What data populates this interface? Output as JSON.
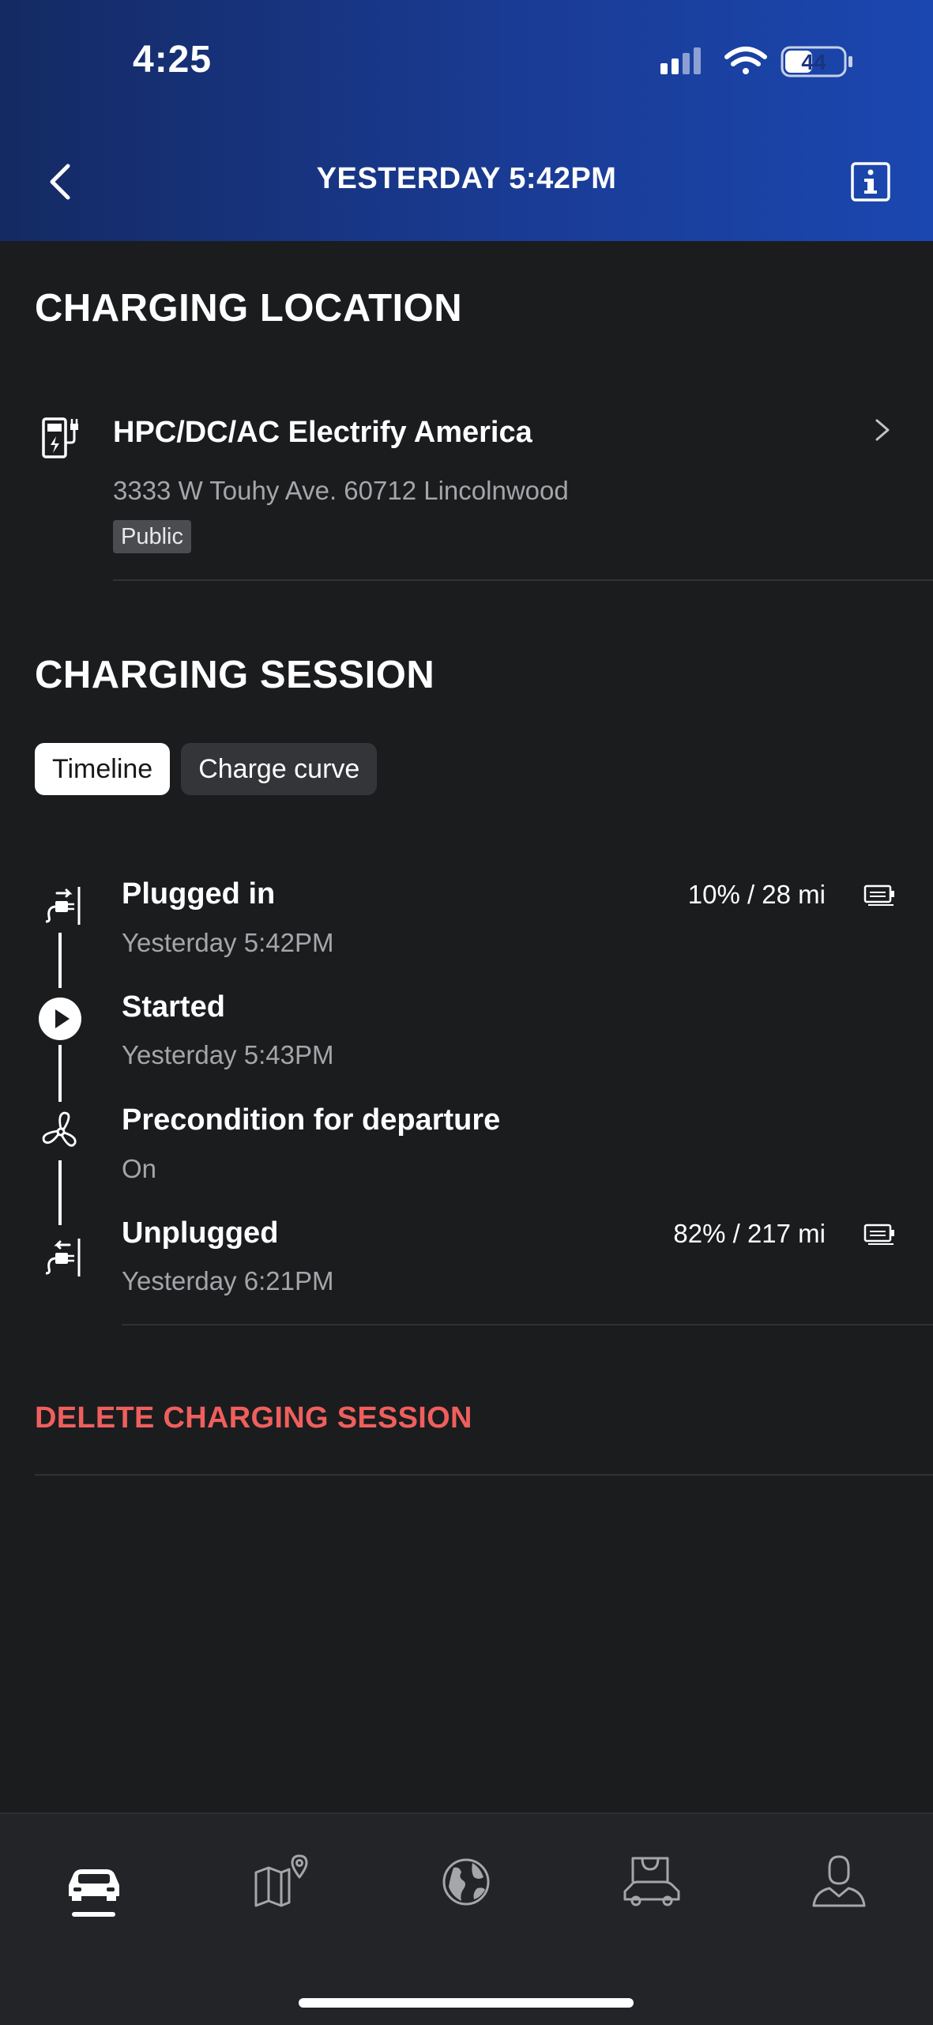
{
  "status_bar": {
    "time": "4:25",
    "battery": "44"
  },
  "nav": {
    "title": "YESTERDAY 5:42PM"
  },
  "charging_location": {
    "heading": "CHARGING LOCATION",
    "name": "HPC/DC/AC Electrify America",
    "address": "3333 W Touhy Ave. 60712 Lincolnwood",
    "badge": "Public"
  },
  "charging_session": {
    "heading": "CHARGING SESSION",
    "tabs": [
      {
        "label": "Timeline",
        "active": true
      },
      {
        "label": "Charge curve",
        "active": false
      }
    ],
    "events": [
      {
        "title": "Plugged in",
        "subtitle": "Yesterday 5:42PM",
        "right": "10% / 28 mi",
        "icon": "plug-icon"
      },
      {
        "title": "Started",
        "subtitle": "Yesterday 5:43PM",
        "icon": "play-circle-icon"
      },
      {
        "title": "Precondition for departure",
        "subtitle": "On",
        "icon": "fan-icon"
      },
      {
        "title": "Unplugged",
        "subtitle": "Yesterday 6:21PM",
        "right": "82% / 217 mi",
        "icon": "unplug-icon"
      }
    ]
  },
  "actions": {
    "delete_label": "DELETE CHARGING SESSION"
  },
  "tab_bar": {
    "items": [
      {
        "icon": "car-icon",
        "active": true
      },
      {
        "icon": "map-pin-icon",
        "active": false
      },
      {
        "icon": "globe-icon",
        "active": false
      },
      {
        "icon": "shop-car-icon",
        "active": false
      },
      {
        "icon": "profile-icon",
        "active": false
      }
    ]
  },
  "colors": {
    "background": "#1b1c1e",
    "header_gradient_start": "#142a63",
    "header_gradient_end": "#1b47b0",
    "delete_red": "#ef5f5d",
    "muted_text": "#a4a6aa"
  }
}
